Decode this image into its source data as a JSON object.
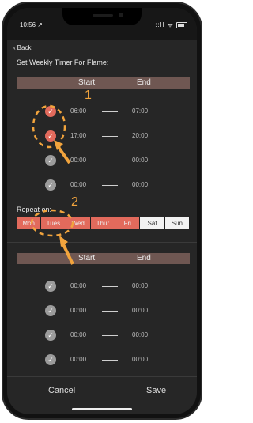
{
  "status": {
    "time": "10:56 ↗",
    "icons": "::ll ᯤ"
  },
  "nav": {
    "back": "Back"
  },
  "title": "Set Weekly Timer For Flame:",
  "headers": {
    "start": "Start",
    "end": "End"
  },
  "group1": [
    {
      "start": "06:00",
      "end": "07:00",
      "checked": true
    },
    {
      "start": "17:00",
      "end": "20:00",
      "checked": true
    },
    {
      "start": "00:00",
      "end": "00:00",
      "checked": false
    },
    {
      "start": "00:00",
      "end": "00:00",
      "checked": false
    }
  ],
  "repeat": {
    "label": "Repeat on:"
  },
  "days": [
    {
      "label": "Mon",
      "selected": true
    },
    {
      "label": "Tues",
      "selected": true
    },
    {
      "label": "Wed",
      "selected": true
    },
    {
      "label": "Thur",
      "selected": true
    },
    {
      "label": "Fri",
      "selected": true
    },
    {
      "label": "Sat",
      "selected": false
    },
    {
      "label": "Sun",
      "selected": false
    }
  ],
  "group2": [
    {
      "start": "00:00",
      "end": "00:00",
      "checked": false
    },
    {
      "start": "00:00",
      "end": "00:00",
      "checked": false
    },
    {
      "start": "00:00",
      "end": "00:00",
      "checked": false
    },
    {
      "start": "00:00",
      "end": "00:00",
      "checked": false
    }
  ],
  "footer": {
    "cancel": "Cancel",
    "save": "Save"
  },
  "annotations": {
    "one": "1",
    "two": "2"
  },
  "colors": {
    "accent": "#e26a5c",
    "header": "#6f5752",
    "annotation": "#f2a43d"
  }
}
